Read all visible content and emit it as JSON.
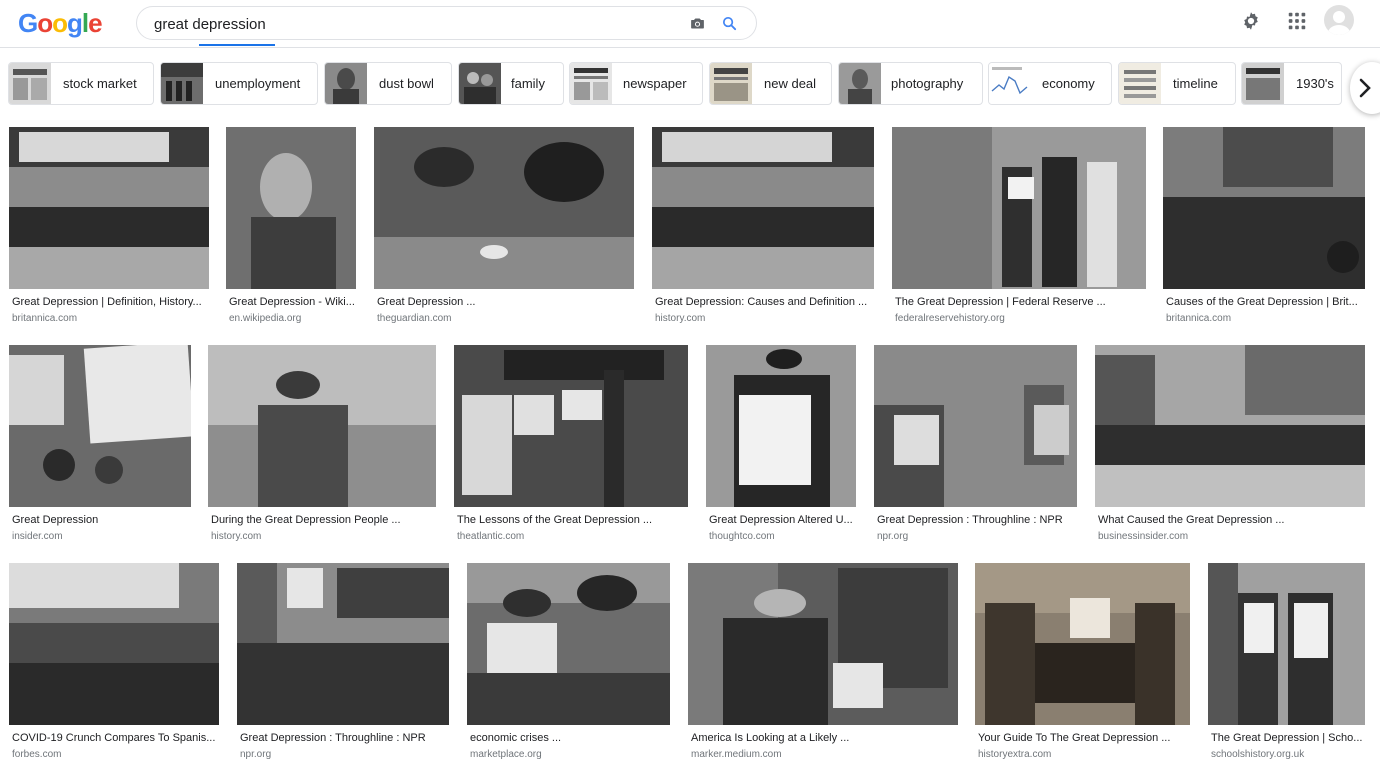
{
  "search": {
    "query": "great depression",
    "logo_letters": [
      "G",
      "o",
      "o",
      "g",
      "l",
      "e"
    ],
    "logo_colors": [
      "#4285f4",
      "#ea4335",
      "#fbbc05",
      "#4285f4",
      "#34a853",
      "#ea4335"
    ]
  },
  "header_icons": {
    "camera": "camera-icon",
    "search": "search-icon",
    "settings": "gear-icon",
    "apps": "apps-grid-icon",
    "account": "account-avatar"
  },
  "chips": [
    {
      "label": "stock market"
    },
    {
      "label": "unemployment"
    },
    {
      "label": "dust bowl"
    },
    {
      "label": "family"
    },
    {
      "label": "newspaper"
    },
    {
      "label": "new deal"
    },
    {
      "label": "photography"
    },
    {
      "label": "economy"
    },
    {
      "label": "timeline"
    },
    {
      "label": "1930's"
    }
  ],
  "results": [
    {
      "title": "Great Depression | Definition, History...",
      "domain": "britannica.com"
    },
    {
      "title": "Great Depression - Wiki...",
      "domain": "en.wikipedia.org"
    },
    {
      "title": "Great Depression ...",
      "domain": "theguardian.com"
    },
    {
      "title": "Great Depression: Causes and Definition ...",
      "domain": "history.com"
    },
    {
      "title": "The Great Depression | Federal Reserve ...",
      "domain": "federalreservehistory.org"
    },
    {
      "title": "Causes of the Great Depression | Brit...",
      "domain": "britannica.com"
    },
    {
      "title": "Great Depression",
      "domain": "insider.com"
    },
    {
      "title": "During the Great Depression People ...",
      "domain": "history.com"
    },
    {
      "title": "The Lessons of the Great Depression ...",
      "domain": "theatlantic.com"
    },
    {
      "title": "Great Depression Altered U...",
      "domain": "thoughtco.com"
    },
    {
      "title": "Great Depression : Throughline : NPR",
      "domain": "npr.org"
    },
    {
      "title": "What Caused the Great Depression ...",
      "domain": "businessinsider.com"
    },
    {
      "title": "COVID-19 Crunch Compares To Spanis...",
      "domain": "forbes.com"
    },
    {
      "title": "Great Depression : Throughline : NPR",
      "domain": "npr.org"
    },
    {
      "title": "economic crises ...",
      "domain": "marketplace.org"
    },
    {
      "title": "America Is Looking at a Likely ...",
      "domain": "marker.medium.com"
    },
    {
      "title": "Your Guide To The Great Depression ...",
      "domain": "historyextra.com"
    },
    {
      "title": "The Great Depression | Scho...",
      "domain": "schoolshistory.org.uk"
    }
  ],
  "colors": {
    "accent": "#1a73e8",
    "border": "#dfe1e5",
    "domain_text": "#70757a"
  }
}
